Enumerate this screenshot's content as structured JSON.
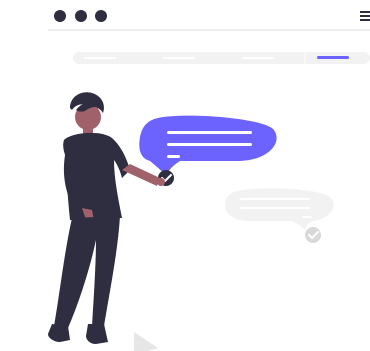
{
  "palette": {
    "accent": "#6C63FF",
    "dark": "#2F2E41",
    "skin": "#A0616A",
    "hair": "#2F2E41",
    "light_gray": "#F2F2F2",
    "mid_gray": "#E6E6E6",
    "check_gray": "#D9D9D9",
    "white": "#FFFFFF"
  },
  "icons": {
    "window_controls": [
      "window-dot-icon",
      "window-dot-icon",
      "window-dot-icon"
    ],
    "menu": "hamburger-menu-icon",
    "check_primary": "checkmark-icon",
    "check_secondary": "checkmark-icon"
  },
  "browser": {
    "nav_tabs": [
      {
        "active": false
      },
      {
        "active": false
      },
      {
        "active": false
      },
      {
        "active": true
      }
    ]
  },
  "bubbles": [
    {
      "state": "active",
      "lines": 3
    },
    {
      "state": "inactive",
      "lines": 3
    }
  ]
}
